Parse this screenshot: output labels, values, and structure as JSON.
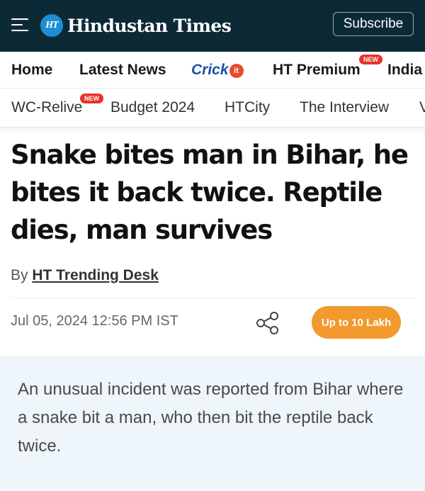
{
  "header": {
    "logo_badge": "HT",
    "logo_text": "Hindustan Times",
    "subscribe_label": "Subscribe"
  },
  "nav_primary": {
    "home": "Home",
    "latest_news": "Latest News",
    "cricket": "Crick",
    "cricket_badge": "it",
    "ht_premium": "HT Premium",
    "ht_premium_badge": "NEW",
    "india": "India"
  },
  "nav_secondary": {
    "wc_relive": "WC-Relive",
    "wc_relive_badge": "NEW",
    "budget": "Budget 2024",
    "htcity": "HTCity",
    "interview": "The Interview",
    "overflow": "V"
  },
  "article": {
    "headline": "Snake bites man in Bihar, he bites it back twice. Reptile dies, man survives",
    "byline_prefix": "By",
    "author": "HT Trending Desk",
    "date": "Jul 05, 2024 12:56 PM IST",
    "promo_label": "Up to 10 Lakh",
    "summary": "An unusual incident was reported from Bihar where a snake bit a man, who then bit the reptile back twice."
  },
  "icons": {
    "menu": "hamburger-menu-icon",
    "share": "share-icon"
  },
  "colors": {
    "header_bg": "#0c2a36",
    "logo_badge": "#1b8fd1",
    "new_badge": "#e8322b",
    "cricket_text": "#1e4fa8",
    "promo_button": "#f29a2e",
    "summary_bg": "#eef6fb"
  }
}
